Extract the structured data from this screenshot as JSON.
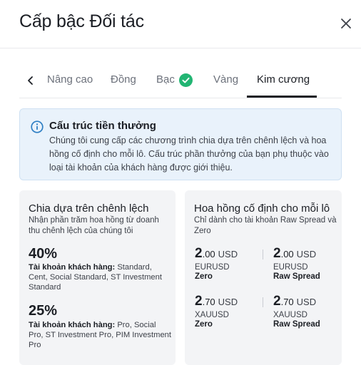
{
  "header": {
    "title": "Cấp bậc Đối tác"
  },
  "tabs": {
    "items": [
      "Nâng cao",
      "Đồng",
      "Bạc",
      "Vàng",
      "Kim cương"
    ],
    "active": "Kim cương"
  },
  "info": {
    "title": "Cấu trúc tiền thưởng",
    "text": "Chúng tôi cung cấp các chương trình chia dựa trên chênh lệch và hoa hồng cố định cho mỗi lô. Cấu trúc phần thưởng của bạn phụ thuộc vào loại tài khoản của khách hàng được giới thiệu."
  },
  "spread": {
    "title": "Chia dựa trên chênh lệch",
    "subtitle": "Nhận phần trăm hoa hồng từ doanh thu chênh lệch của chúng tôi",
    "tiers": [
      {
        "percent": "40%",
        "label": "Tài khoản khách hàng:",
        "accounts": " Standard, Cent, Social Standard, ST Investment Standard"
      },
      {
        "percent": "25%",
        "label": "Tài khoản khách hàng:",
        "accounts": " Pro, Social Pro, ST Investment Pro, PIM Investment Pro"
      }
    ]
  },
  "fixed": {
    "title": "Hoa hồng cố định cho mỗi lô",
    "subtitle": "Chỉ dành cho tài khoản Raw Spread và Zero",
    "fees": [
      {
        "int": "2",
        "dec": ".00",
        "currency": "USD",
        "symbol": "EURUSD",
        "account": "Zero"
      },
      {
        "int": "2",
        "dec": ".00",
        "currency": "USD",
        "symbol": "EURUSD",
        "account": "Raw Spread"
      },
      {
        "int": "2",
        "dec": ".70",
        "currency": "USD",
        "symbol": "XAUUSD",
        "account": "Zero"
      },
      {
        "int": "2",
        "dec": ".70",
        "currency": "USD",
        "symbol": "XAUUSD",
        "account": "Raw Spread"
      }
    ]
  },
  "colors": {
    "accent": "#1b1e24",
    "success": "#22b573",
    "info_bg": "#e9f2fb",
    "info_icon": "#2f7fc4"
  }
}
